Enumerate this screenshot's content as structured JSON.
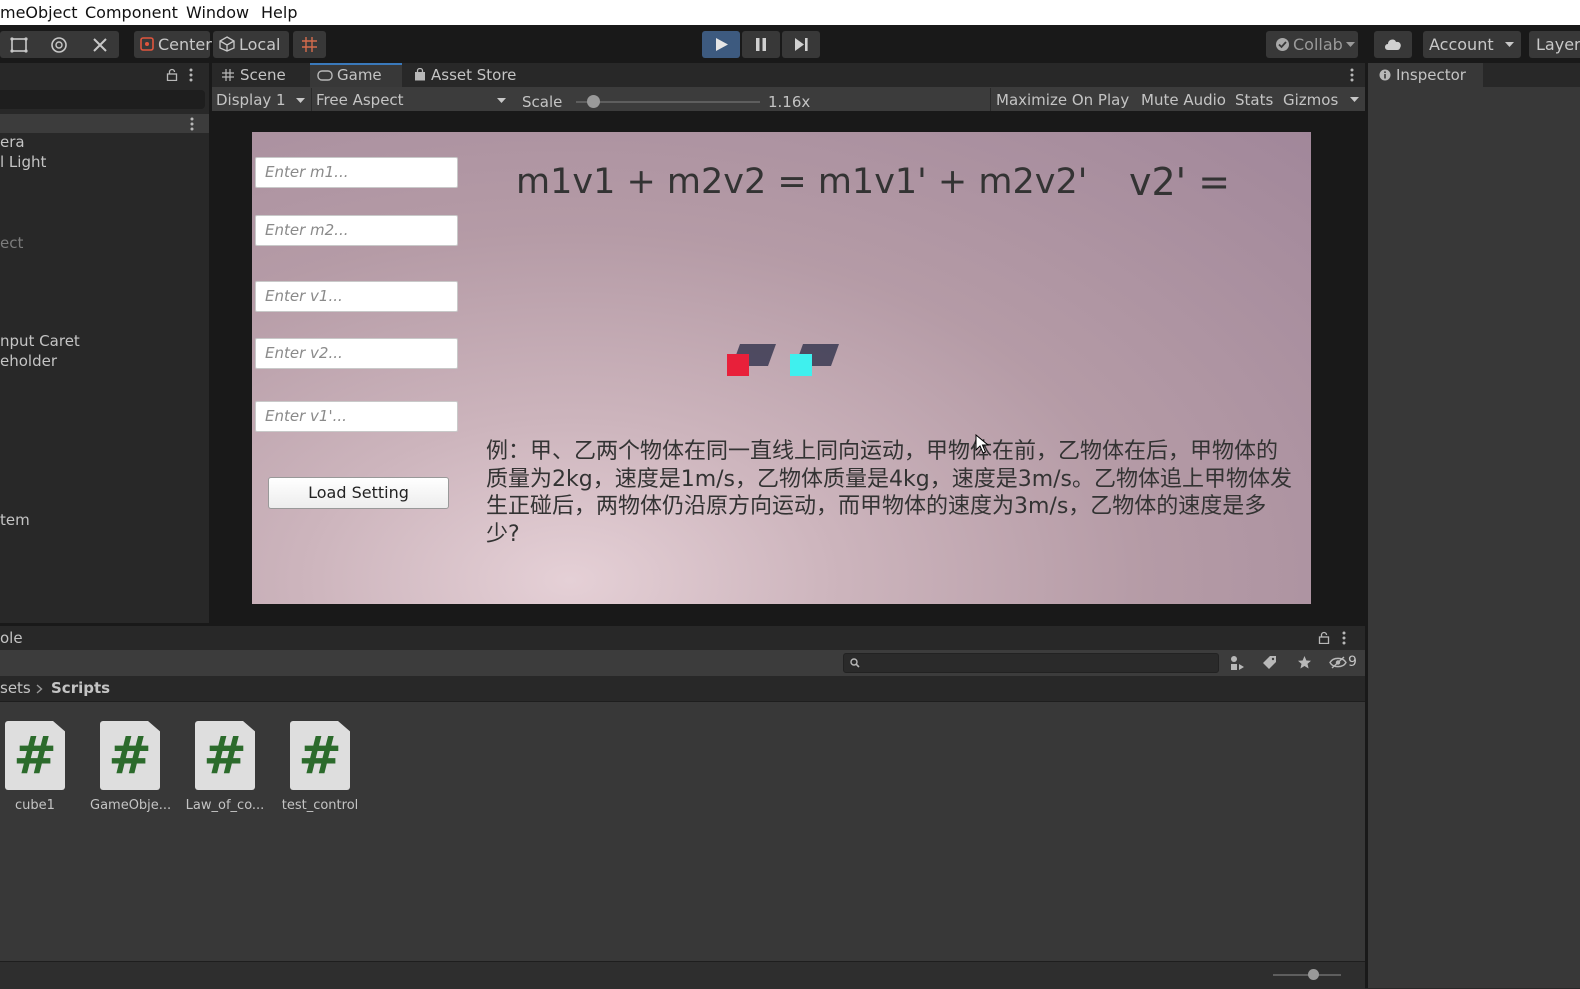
{
  "menu": [
    "meObject",
    "Component",
    "Window",
    "Help"
  ],
  "toolbar": {
    "pivot_mode": "Center",
    "pivot_space": "Local",
    "collab": "Collab",
    "account": "Account",
    "layers": "Layer"
  },
  "hierarchy": {
    "items": [
      "era",
      "l Light",
      "ect",
      "nput Caret",
      "eholder",
      "tem"
    ]
  },
  "game_panel": {
    "tabs": [
      "Scene",
      "Game",
      "Asset Store"
    ],
    "active_tab": "Game",
    "display": "Display 1",
    "aspect": "Free Aspect",
    "scale_label": "Scale",
    "scale_value": "1.16x",
    "scale_fraction": 0.09,
    "maximize": "Maximize On Play",
    "mute": "Mute Audio",
    "stats": "Stats",
    "gizmos": "Gizmos"
  },
  "game": {
    "inputs": [
      "Enter m1...",
      "Enter m2...",
      "Enter v1...",
      "Enter v2...",
      "Enter v1'..."
    ],
    "load_button": "Load Setting",
    "equation": "m1v1 + m2v2 = m1v1' + m2v2'",
    "v2_label": "v2' =",
    "problem": "例：甲、乙两个物体在同一直线上同向运动，甲物体在前，乙物体在后，甲物体的质量为2kg，速度是1m/s，乙物体质量是4kg，速度是3m/s。乙物体追上甲物体发生正碰后，两物体仍沿原方向运动，而甲物体的速度为3m/s，乙物体的速度是多少?",
    "cube_colors": [
      "#e8203a",
      "#3ff0ee"
    ]
  },
  "inspector": {
    "title": "Inspector"
  },
  "project": {
    "tab": "ole",
    "breadcrumb_parent": "sets",
    "breadcrumb_current": "Scripts",
    "hidden_count": "9",
    "assets": [
      "cube1",
      "GameObje...",
      "Law_of_co...",
      "test_control"
    ],
    "asset_glyph": "#"
  }
}
